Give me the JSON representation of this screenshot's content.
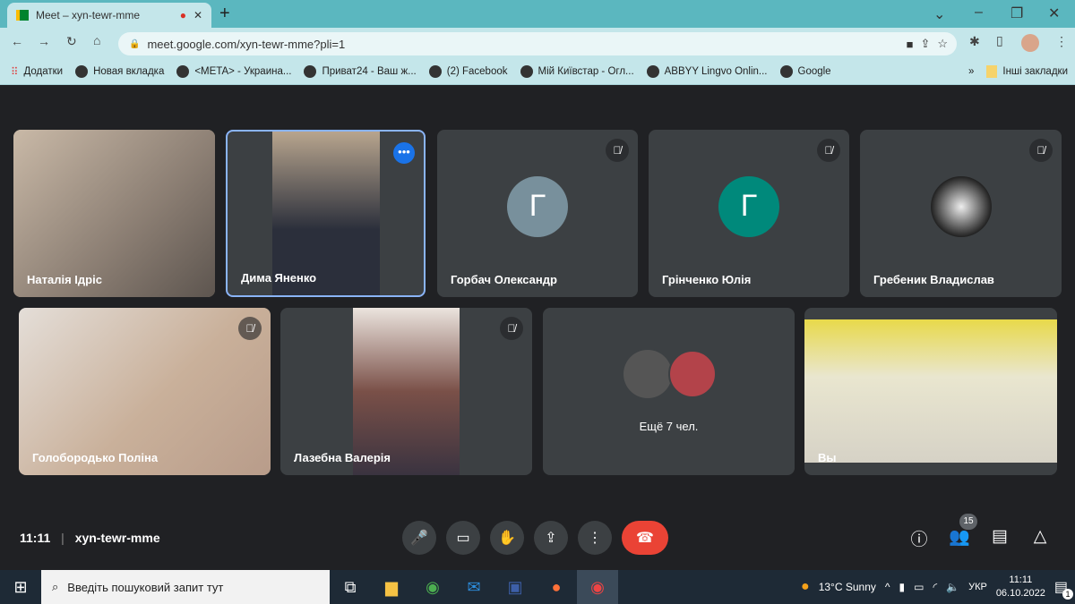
{
  "browser": {
    "tab_title": "Meet – xyn-tewr-mme",
    "url": "meet.google.com/xyn-tewr-mme?pli=1",
    "bookmarks": [
      "Додатки",
      "Новая вкладка",
      "<META> - Украина...",
      "Приват24 - Ваш ж...",
      "(2) Facebook",
      "Мій Київстар - Огл...",
      "ABBYY Lingvo Onlin...",
      "Google"
    ],
    "more": "»",
    "other_bookmarks": "Інші закладки"
  },
  "participants": [
    {
      "name": "Наталія Ідріс"
    },
    {
      "name": "Дима Яненко"
    },
    {
      "name": "Горбач Олександр",
      "initial": "Г",
      "color": "#78909c"
    },
    {
      "name": "Грінченко Юлія",
      "initial": "Г",
      "color": "#00897b"
    },
    {
      "name": "Гребеник Владислав"
    },
    {
      "name": "Голобородько Поліна"
    },
    {
      "name": "Лазебна Валерія"
    },
    {
      "name": "Ещё 7 чел."
    },
    {
      "name": "Вы"
    }
  ],
  "meeting": {
    "time": "11:11",
    "code": "xyn-tewr-mme",
    "participant_count": "15"
  },
  "taskbar": {
    "search_placeholder": "Введіть пошуковий запит тут",
    "weather": "13°C  Sunny",
    "lang": "УКР",
    "time": "11:11",
    "date": "06.10.2022",
    "notifications": "1"
  }
}
